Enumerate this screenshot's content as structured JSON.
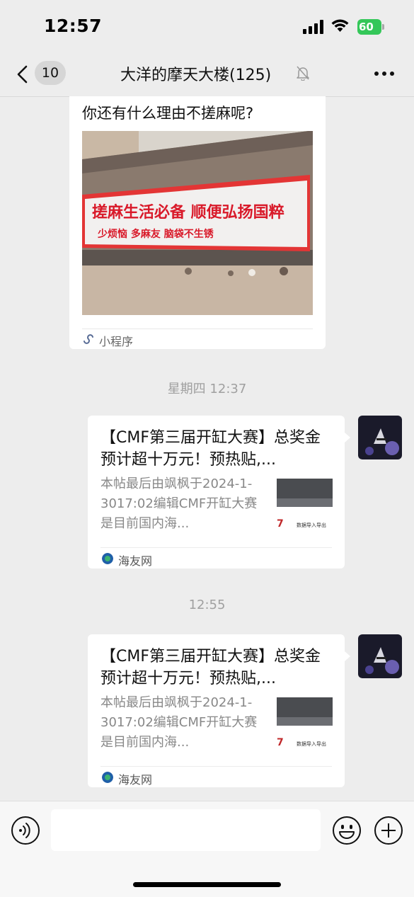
{
  "status_bar": {
    "time": "12:57",
    "battery": "60"
  },
  "nav": {
    "back_badge": "10",
    "title": "大洋的摩天大楼(125)"
  },
  "messages": {
    "mini_program": {
      "title": "你还有什么理由不搓麻呢?",
      "image_text_main": "搓麻生活必备 顺便弘扬国粹",
      "image_text_sub": "少烦恼  多麻友  脑袋不生锈",
      "source_label": "小程序"
    },
    "timestamp_1": "星期四 12:37",
    "link_1": {
      "title": "【CMF第三届开缸大赛】总奖金预计超十万元！预热贴,...",
      "desc": "本帖最后由飒枫于2024-1-3017:02编辑CMF开缸大赛是目前国内海...",
      "thumb_caption": "数据导入导出",
      "thumb_number": "7",
      "source_label": "海友网"
    },
    "timestamp_2": "12:55",
    "link_2": {
      "title": "【CMF第三届开缸大赛】总奖金预计超十万元！预热贴,...",
      "desc": "本帖最后由飒枫于2024-1-3017:02编辑CMF开缸大赛是目前国内海...",
      "thumb_caption": "数据导入导出",
      "thumb_number": "7",
      "source_label": "海友网"
    }
  },
  "input_bar": {
    "text_value": "",
    "placeholder": ""
  },
  "icons": [
    "back-icon",
    "mute-bell-icon",
    "more-icon",
    "voice-icon",
    "emoji-icon",
    "plus-icon",
    "mini-program-icon",
    "site-favicon"
  ],
  "colors": {
    "background": "#ededed",
    "card": "#ffffff",
    "battery": "#34c759",
    "banner_red": "#d91a2a"
  }
}
